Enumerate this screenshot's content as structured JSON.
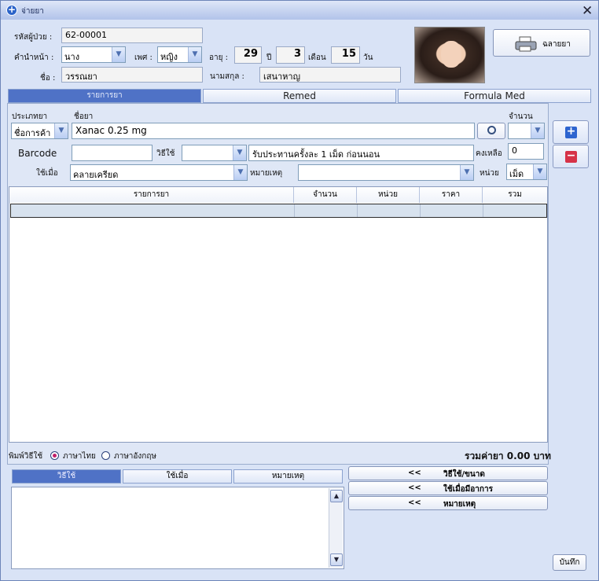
{
  "window": {
    "title": "จ่ายยา",
    "close": "✕"
  },
  "patient": {
    "hn_label": "รหัสผู้ป่วย :",
    "hn": "62-00001",
    "prefix_label": "คำนำหน้า :",
    "prefix": "นาง",
    "sex_label": "เพศ :",
    "sex": "หญิง",
    "age_label": "อายุ :",
    "years": "29",
    "years_unit": "ปี",
    "months": "3",
    "months_unit": "เดือน",
    "days": "15",
    "days_unit": "วัน",
    "name_label": "ชื่อ :",
    "name": "วรรณยา",
    "surname_label": "นามสกุล :",
    "surname": "เสนาหาญ"
  },
  "label_button": "ฉลายยา",
  "tabs": [
    "รายการยา",
    "Remed",
    "Formula Med"
  ],
  "form": {
    "type_label": "ประเภทยา",
    "type_value": "ชื่อการค้า",
    "drug_label": "ชื่อยา",
    "drug_value": "Xanac 0.25 mg",
    "qty_label": "จำนวน",
    "qty_value": "",
    "barcode_label": "Barcode",
    "barcode_value": "",
    "usage_label": "วิธีใช้",
    "usage_code": "",
    "usage_text": "รับประทานครั้งละ 1 เม็ด ก่อนนอน",
    "remain_label": "คงเหลือ",
    "remain_value": "0",
    "when_label": "ใช้เมื่อ",
    "when_value": "คลายเครียด",
    "note_label": "หมายเหตุ",
    "note_value": "",
    "unit_label": "หน่วย",
    "unit_value": "เม็ด"
  },
  "table": {
    "headers": [
      "รายการยา",
      "จำนวน",
      "หน่วย",
      "ราคา",
      "รวม"
    ]
  },
  "print": {
    "label": "พิมพ์วิธีใช้",
    "thai": "ภาษาไทย",
    "english": "ภาษาอังกฤษ",
    "selected": "thai"
  },
  "total": "รวมค่ายา 0.00 บาท",
  "bottom_tabs": [
    "วิธีใช้",
    "ใช้เมื่อ",
    "หมายเหตุ"
  ],
  "action_buttons": [
    {
      "arrow": "<<",
      "label": "วิธีใช้/ขนาด"
    },
    {
      "arrow": "<<",
      "label": "ใช้เมื่อมีอาการ"
    },
    {
      "arrow": "<<",
      "label": "หมายเหตุ"
    }
  ],
  "save": "บันทึก",
  "colors": {
    "tab_active": "#4f72c6",
    "add": "#2d64cf",
    "remove": "#d63248"
  }
}
